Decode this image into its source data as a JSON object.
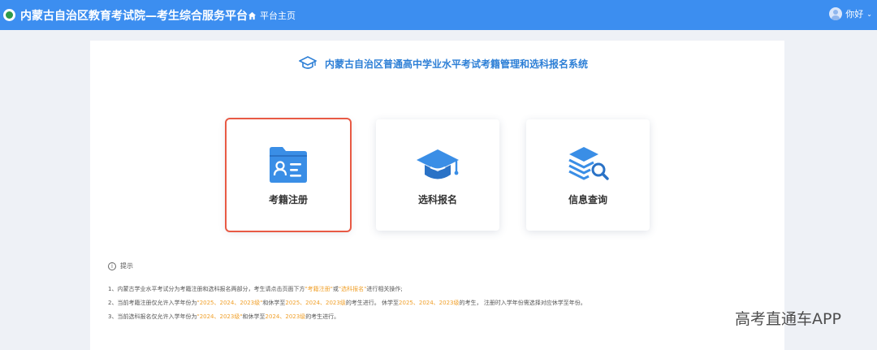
{
  "header": {
    "app_title": "内蒙古自治区教育考试院—考生综合服务平台",
    "home_label": "平台主页",
    "user_label": "你好",
    "brand_color": "#3c8ef0"
  },
  "main": {
    "system_title": "内蒙古自治区普通高中学业水平考试考籍管理和选科报名系统",
    "cards": [
      {
        "label": "考籍注册",
        "icon": "student-file-icon",
        "selected": true
      },
      {
        "label": "选科报名",
        "icon": "graduation-cap-icon",
        "selected": false
      },
      {
        "label": "信息查询",
        "icon": "layers-search-icon",
        "selected": false
      }
    ]
  },
  "tips": {
    "heading": "提示",
    "line1": {
      "a": "1、内蒙古学业水平考试分为考籍注册和选科报名两部分，考生请点击页面下方",
      "h1": "\"考籍注册\"",
      "b": "或",
      "h2": "\"选科报名\"",
      "c": "进行相关操作;"
    },
    "line2": {
      "a": "2、当前考籍注册仅允许入学年份为",
      "h1": "\"2025、2024、2023级\"",
      "b": "和休学至",
      "h2": "2025、2024、2023级",
      "c": "的考生进行。 休学至",
      "h3": "2025、2024、2023级",
      "d": "的考生， 注册时入学年份需选择对应休学至年份。"
    },
    "line3": {
      "a": "3、当前选科报名仅允许入学年份为",
      "h1": "\"2024、2023级\"",
      "b": "和休学至",
      "h2": "2024、2023级",
      "c": "的考生进行。"
    }
  },
  "watermark": "高考直通车APP",
  "colors": {
    "highlight": "#f0a02a",
    "selected_outline": "#e85a45",
    "title_blue": "#2d7fd6"
  }
}
